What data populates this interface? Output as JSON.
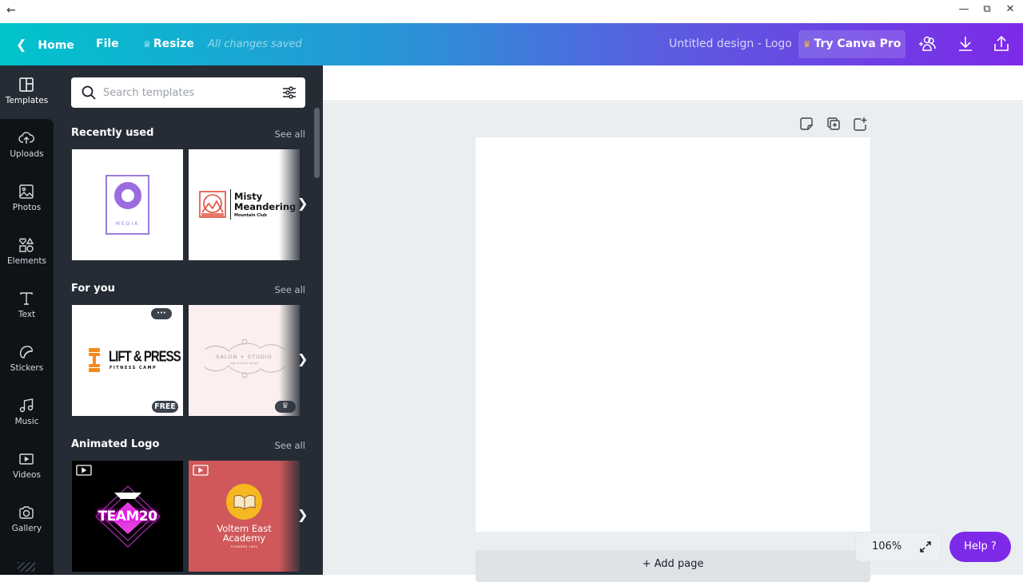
{
  "window": {
    "back_icon": "arrow-left",
    "controls": [
      "minimize",
      "restore",
      "close"
    ]
  },
  "header": {
    "home_label": "Home",
    "file_label": "File",
    "resize_label": "Resize",
    "save_status": "All changes saved",
    "design_title": "Untitled design - Logo",
    "pro_label": "Try Canva Pro",
    "icons": [
      "add-people-icon",
      "download-icon",
      "share-icon"
    ]
  },
  "rail": {
    "items": [
      {
        "label": "Templates",
        "icon": "templates-icon",
        "active": true
      },
      {
        "label": "Uploads",
        "icon": "upload-cloud-icon"
      },
      {
        "label": "Photos",
        "icon": "image-icon"
      },
      {
        "label": "Elements",
        "icon": "shapes-icon"
      },
      {
        "label": "Text",
        "icon": "text-icon"
      },
      {
        "label": "Stickers",
        "icon": "sticker-icon"
      },
      {
        "label": "Music",
        "icon": "music-note-icon"
      },
      {
        "label": "Videos",
        "icon": "video-icon"
      },
      {
        "label": "Gallery",
        "icon": "camera-icon"
      }
    ]
  },
  "panel": {
    "search_placeholder": "Search templates",
    "sections": [
      {
        "title": "Recently used",
        "see_all": "See all",
        "items": [
          {
            "name": "Media logo",
            "text": "MEDIA"
          },
          {
            "name": "Misty Meandering logo",
            "line1": "Misty",
            "line2": "Meandering",
            "line3": "Mountain Club"
          }
        ]
      },
      {
        "title": "For you",
        "see_all": "See all",
        "items": [
          {
            "name": "Lift & Press logo",
            "line1": "LIFT & PRESS",
            "line2": "FITNESS CAMP",
            "badge": "FREE",
            "menu": "···"
          },
          {
            "name": "Salon Studio logo",
            "line1": "SALON + STUDIO",
            "line2": "high end hair design",
            "badge": "pro-crown"
          }
        ]
      },
      {
        "title": "Animated Logo",
        "see_all": "See all",
        "items": [
          {
            "name": "Team20 logo",
            "text": "TEAM20"
          },
          {
            "name": "Voltem East Academy logo",
            "line1": "Voltem East",
            "line2": "Academy",
            "line3": "FOUNDED 1895"
          }
        ]
      }
    ]
  },
  "canvas": {
    "add_page_label": "+ Add page",
    "zoom_level": "106%",
    "help_label": "Help  ?",
    "page_tools": [
      "notes-icon",
      "duplicate-page-icon",
      "add-page-icon"
    ]
  },
  "colors": {
    "brand_gradient_start": "#00c4cc",
    "brand_gradient_end": "#7d2ae8",
    "help_button": "#7d2ae8",
    "panel_bg": "#252c36",
    "rail_bg": "#0e1318",
    "workspace_bg": "#ebeef1"
  }
}
